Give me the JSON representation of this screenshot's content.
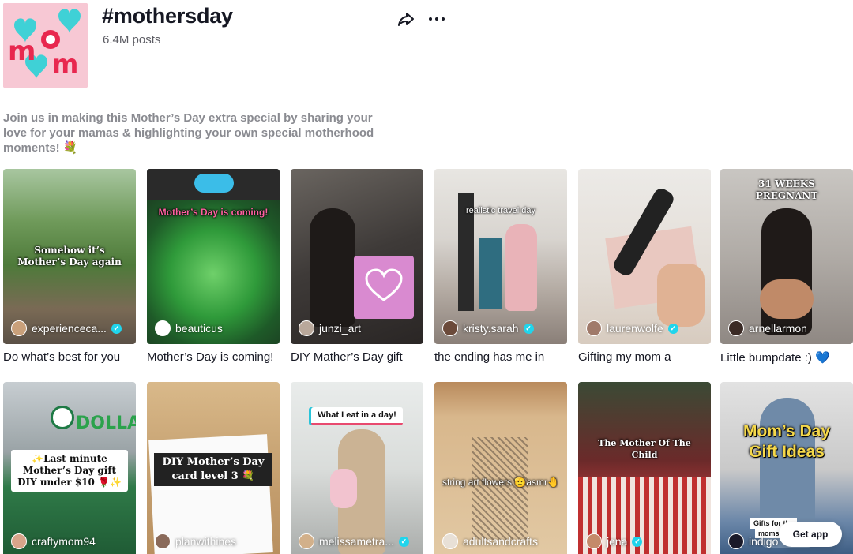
{
  "header": {
    "title": "#mothersday",
    "posts": "6.4M posts",
    "description": "Join us in making this Mother’s Day extra special by sharing your love for your mamas & highlighting your own special motherhood moments! 💐"
  },
  "videos": [
    {
      "user": "experienceca...",
      "verified": true,
      "caption": "Do what’s best for you",
      "overlay": "Somehow it’s Mother’s Day again"
    },
    {
      "user": "beauticus",
      "verified": false,
      "caption": "Mother’s Day is coming!",
      "overlay": "Mother’s Day is coming!"
    },
    {
      "user": "junzi_art",
      "verified": false,
      "caption": "DIY Mather’s Day gift",
      "overlay": ""
    },
    {
      "user": "kristy.sarah",
      "verified": true,
      "caption": "the ending has me in",
      "overlay": "realistic travel day"
    },
    {
      "user": "laurenwolfe",
      "verified": true,
      "caption": "Gifting my mom a",
      "overlay": ""
    },
    {
      "user": "arnellarmon",
      "verified": false,
      "caption": "Little bumpdate :) 💙",
      "overlay": "31 WEEKS PREGNANT"
    },
    {
      "user": "craftymom94",
      "verified": false,
      "caption": "",
      "overlay": "✨Last minute Mother’s Day gift DIY under $10 🌹✨"
    },
    {
      "user": "planwithines",
      "verified": false,
      "caption": "",
      "overlay": "DIY Mother’s Day card level 3 💐"
    },
    {
      "user": "melissametra...",
      "verified": true,
      "caption": "",
      "overlay": "What I eat in a day!"
    },
    {
      "user": "adultsandcrafts",
      "verified": false,
      "caption": "",
      "overlay": "string art flowers 🫡asmr🤚"
    },
    {
      "user": "jena",
      "verified": true,
      "caption": "",
      "overlay": "The Mother Of The Child"
    },
    {
      "user": "indigo",
      "verified": false,
      "caption": "",
      "overlay": "Mom’s Day Gift Ideas"
    }
  ],
  "extra_overlay_text": "Gifts for the",
  "extra_overlay_text2": "moms",
  "get_app": "Get app",
  "colors": {
    "verified": "#20d5ec",
    "text": "#161823",
    "muted": "#8a8b91"
  }
}
